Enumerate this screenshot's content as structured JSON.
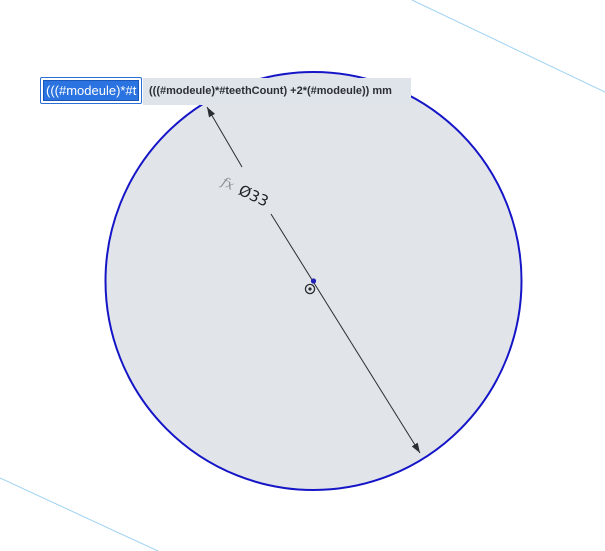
{
  "sketch": {
    "dimension": {
      "fx_label": "fx",
      "value_label": "Ø33"
    },
    "edit_field": {
      "value": "(((#modeule)*#t"
    },
    "preview": {
      "expression": "(((#modeule)*#teethCount) +2*(#modeule)) mm"
    },
    "colors": {
      "circle_stroke": "#1515c8",
      "circle_fill": "#e1e4e8",
      "construction_line": "#9fd3f2",
      "center_point": "#1f1fb8",
      "dimension_line": "#2a2d31"
    }
  }
}
